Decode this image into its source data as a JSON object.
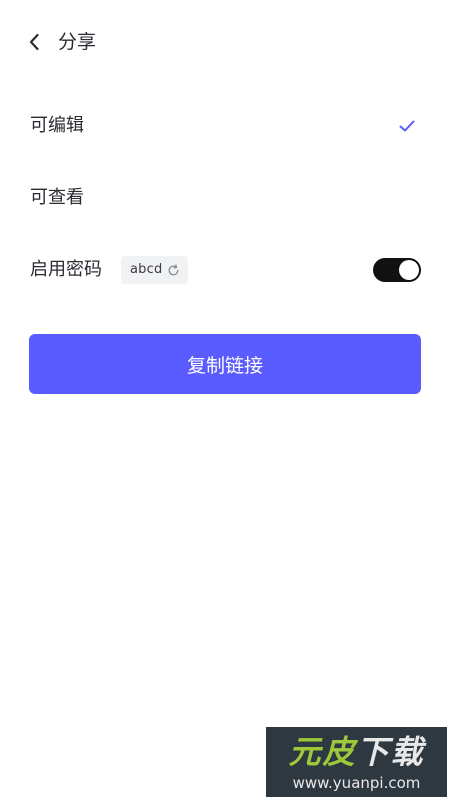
{
  "header": {
    "back_icon": "chevron-left-icon",
    "title": "分享"
  },
  "options": [
    {
      "label": "可编辑",
      "selected": true
    },
    {
      "label": "可查看",
      "selected": false
    }
  ],
  "password": {
    "label": "启用密码",
    "value": "abcd",
    "refresh_icon": "refresh-icon",
    "enabled": true
  },
  "copy_button": {
    "label": "复制链接"
  },
  "watermark": {
    "brand_part1": "元皮",
    "brand_part2": "下载",
    "url": "www.yuanpi.com"
  },
  "colors": {
    "accent": "#5a5cff",
    "toggle_on": "#111111",
    "text": "#2b2b33",
    "chip_bg": "#f1f2f4"
  }
}
